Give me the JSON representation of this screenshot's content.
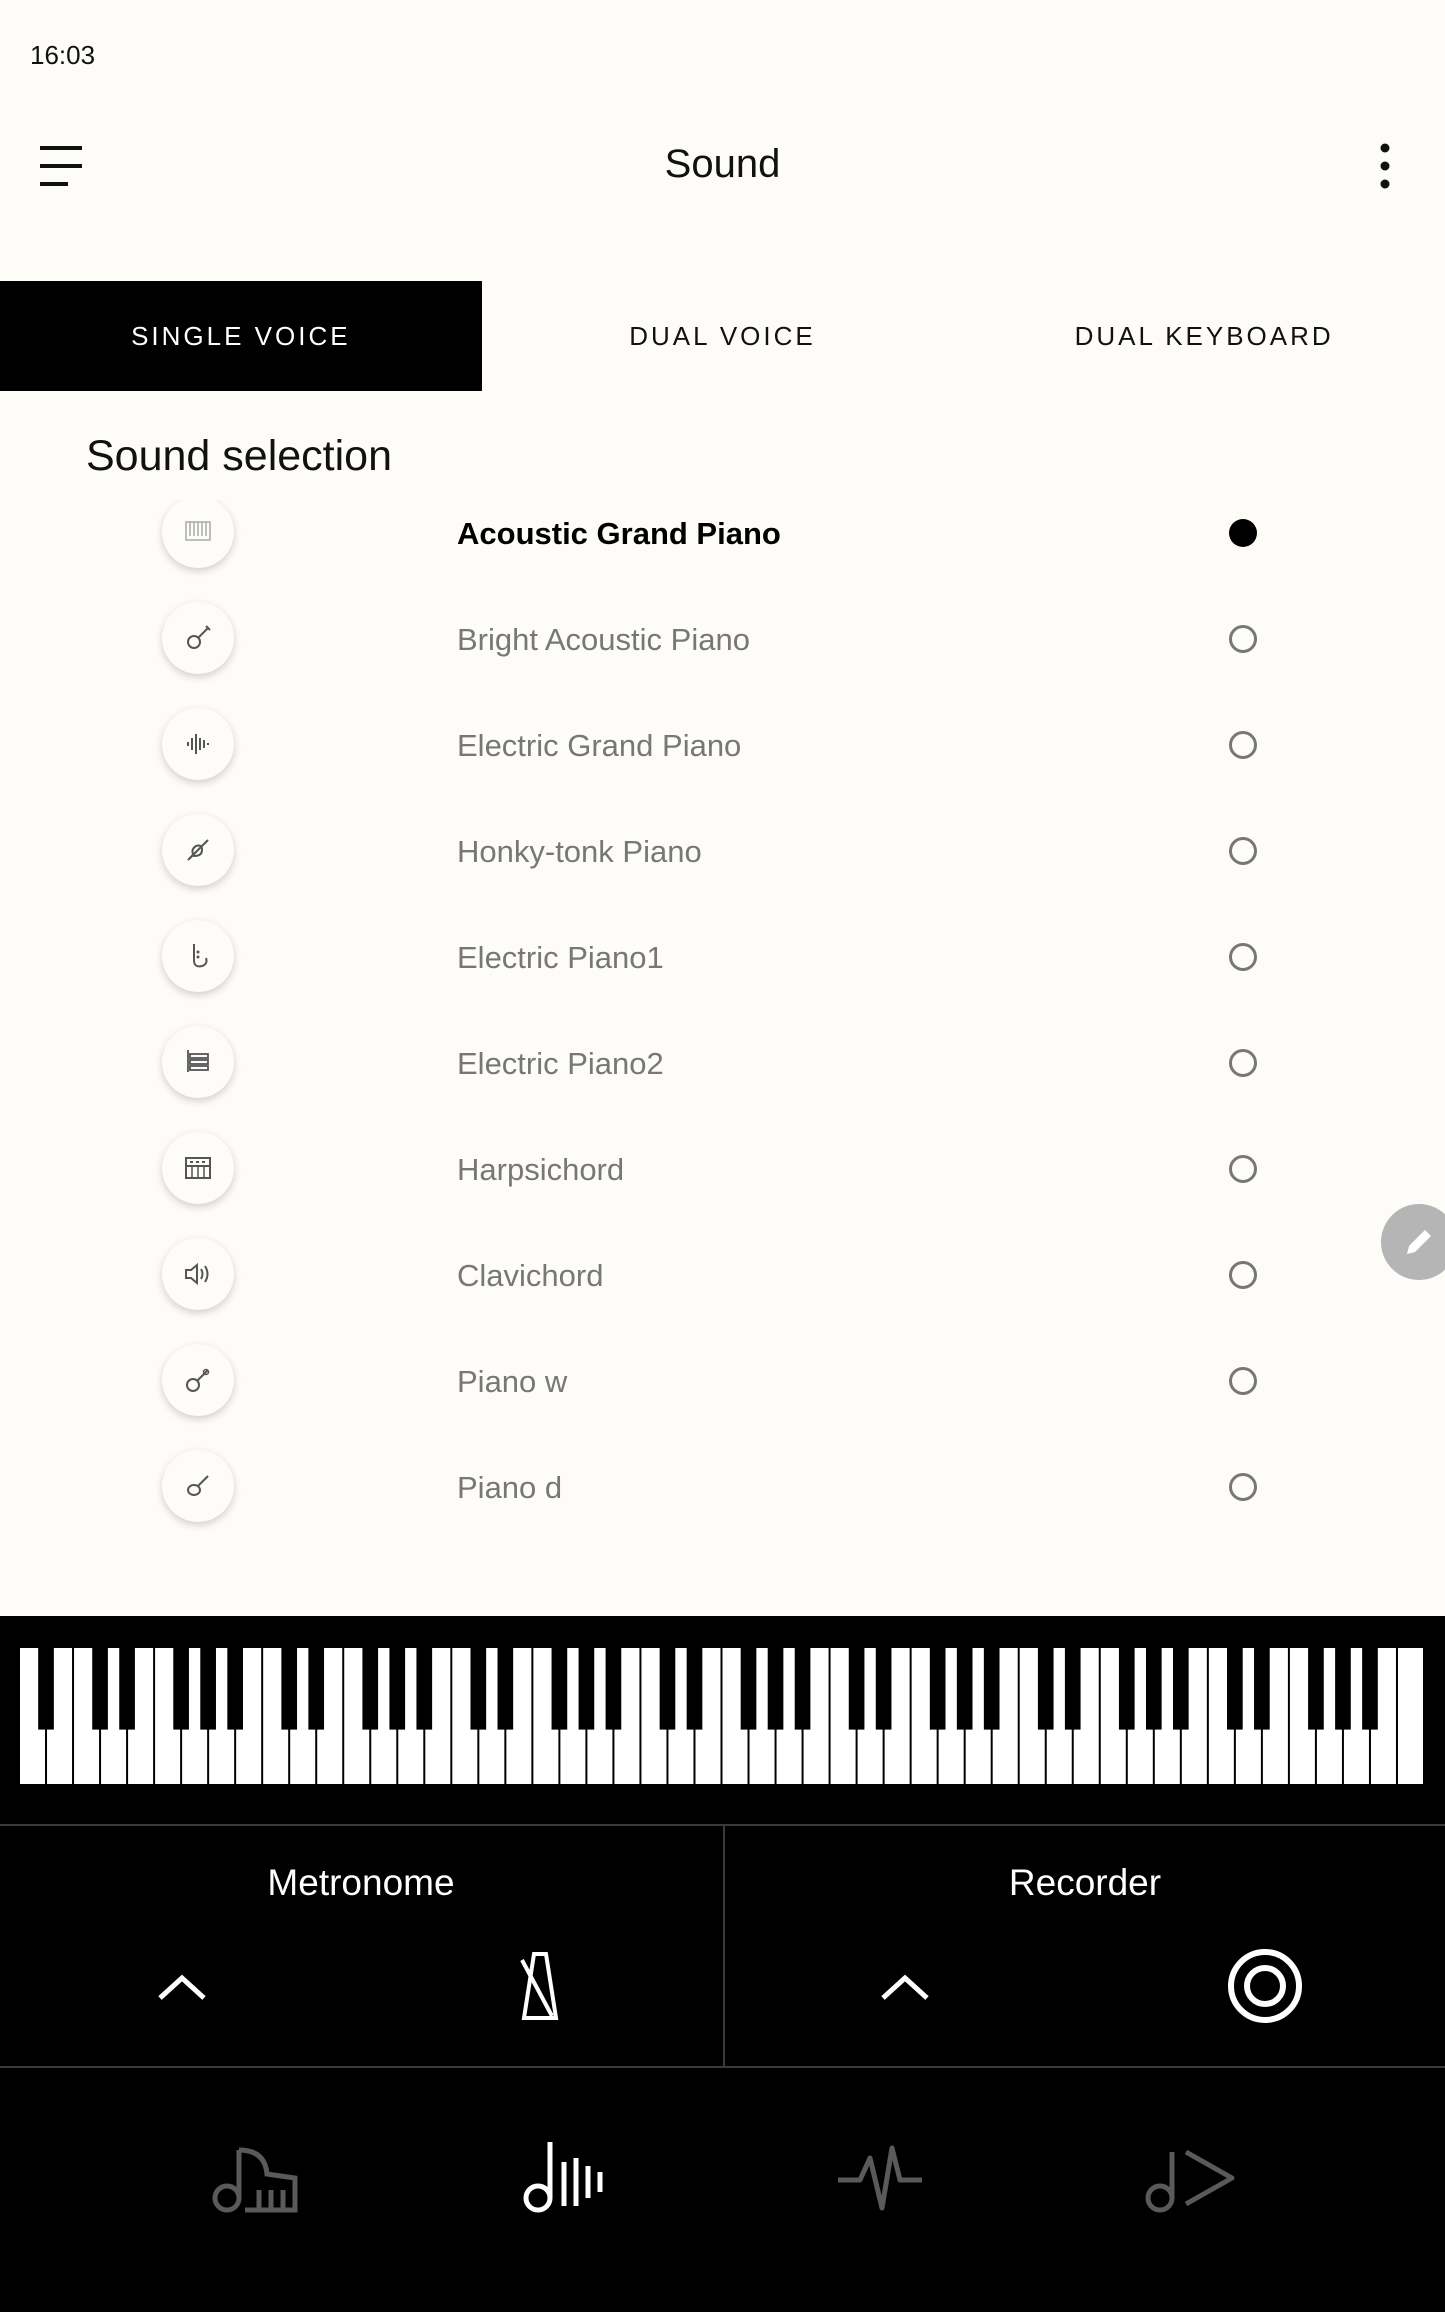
{
  "status_bar": {
    "time": "16:03"
  },
  "app_bar": {
    "title": "Sound"
  },
  "tabs": [
    {
      "label": "SINGLE VOICE",
      "active": true
    },
    {
      "label": "DUAL VOICE",
      "active": false
    },
    {
      "label": "DUAL KEYBOARD",
      "active": false
    }
  ],
  "section_title": "Sound selection",
  "sounds": [
    {
      "name": "Acoustic Grand Piano",
      "icon": "piano-icon",
      "selected": true
    },
    {
      "name": "Bright Acoustic Piano",
      "icon": "guitar-icon",
      "selected": false
    },
    {
      "name": "Electric Grand Piano",
      "icon": "waveform-icon",
      "selected": false
    },
    {
      "name": "Honky-tonk Piano",
      "icon": "strings-icon",
      "selected": false
    },
    {
      "name": "Electric Piano1",
      "icon": "saxophone-icon",
      "selected": false
    },
    {
      "name": "Electric Piano2",
      "icon": "organ-icon",
      "selected": false
    },
    {
      "name": "Harpsichord",
      "icon": "synth-icon",
      "selected": false
    },
    {
      "name": "Clavichord",
      "icon": "speaker-icon",
      "selected": false
    },
    {
      "name": "Piano w",
      "icon": "banjo-icon",
      "selected": false
    },
    {
      "name": "Piano d",
      "icon": "ethnic-instrument-icon",
      "selected": false
    }
  ],
  "controls": {
    "metronome_label": "Metronome",
    "recorder_label": "Recorder"
  },
  "bottom_nav": [
    {
      "icon": "piano-nav-icon",
      "active": false
    },
    {
      "icon": "sound-nav-icon",
      "active": true
    },
    {
      "icon": "pulse-nav-icon",
      "active": false
    },
    {
      "icon": "play-nav-icon",
      "active": false
    }
  ],
  "colors": {
    "background": "#fdfcf8",
    "accent": "#000000",
    "inactive_text": "#777777",
    "nav_inactive": "#5a5a5a"
  }
}
